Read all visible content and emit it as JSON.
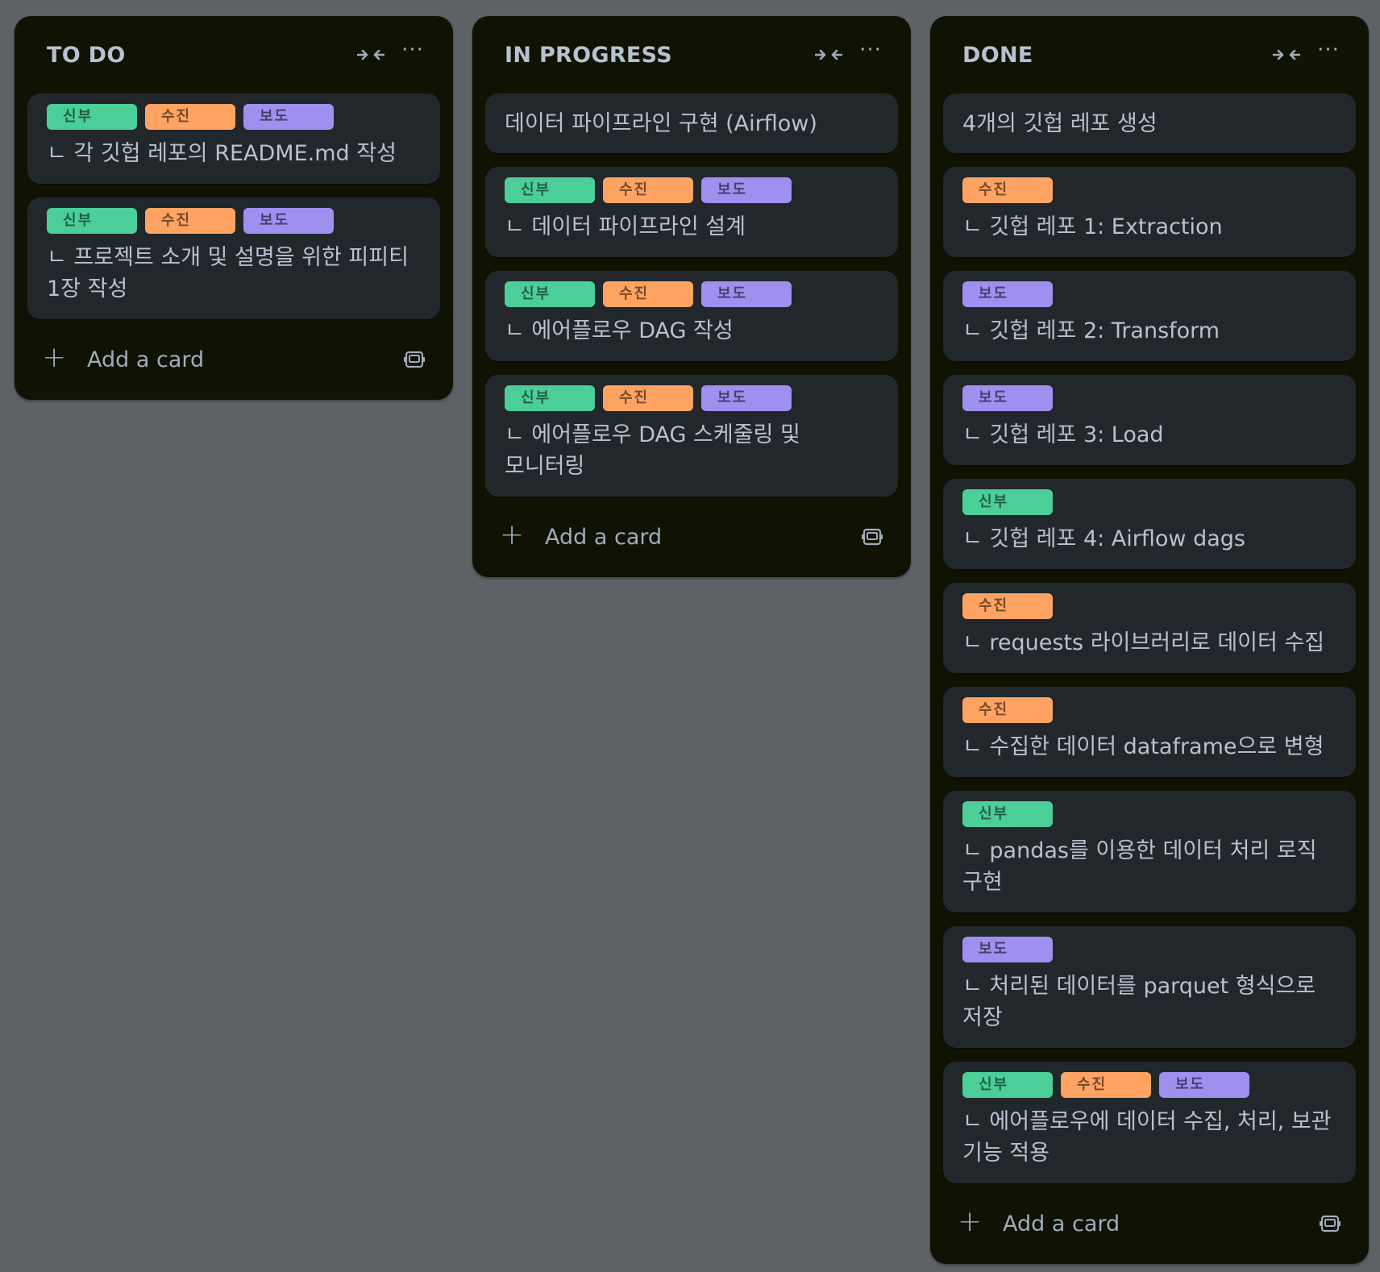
{
  "colors": {
    "background": "#5d6267",
    "list_bg": "#101204",
    "card_bg": "#22272b",
    "text": "#b6c2cf",
    "label_green": "#4bce97",
    "label_orange": "#fea362",
    "label_purple": "#9f8fef"
  },
  "icons": {
    "collapse": "collapse-arrows-icon",
    "menu": "more-dots-icon",
    "add": "plus-icon",
    "template": "card-template-icon"
  },
  "labels": {
    "green": {
      "color": "#4bce97",
      "text": "신부"
    },
    "orange": {
      "color": "#fea362",
      "text": "수진"
    },
    "purple": {
      "color": "#9f8fef",
      "text": "보도"
    }
  },
  "lists": [
    {
      "title": "TO DO",
      "add_label": "Add a card",
      "cards": [
        {
          "labels": [
            "green",
            "orange",
            "purple"
          ],
          "title": "ㄴ 각 깃헙 레포의 README.md 작성"
        },
        {
          "labels": [
            "green",
            "orange",
            "purple"
          ],
          "title": "ㄴ 프로젝트 소개 및 설명을 위한 피피티 1장 작성"
        }
      ]
    },
    {
      "title": "IN PROGRESS",
      "add_label": "Add a card",
      "cards": [
        {
          "labels": [],
          "title": "데이터 파이프라인 구현 (Airflow)"
        },
        {
          "labels": [
            "green",
            "orange",
            "purple"
          ],
          "title": "ㄴ 데이터 파이프라인 설계"
        },
        {
          "labels": [
            "green",
            "orange",
            "purple"
          ],
          "title": "ㄴ 에어플로우 DAG 작성"
        },
        {
          "labels": [
            "green",
            "orange",
            "purple"
          ],
          "title": "ㄴ 에어플로우 DAG 스케줄링 및 모니터링"
        }
      ]
    },
    {
      "title": "DONE",
      "add_label": "Add a card",
      "cards": [
        {
          "labels": [],
          "title": "4개의 깃헙 레포 생성"
        },
        {
          "labels": [
            "orange"
          ],
          "title": "ㄴ 깃헙 레포 1: Extraction"
        },
        {
          "labels": [
            "purple"
          ],
          "title": "ㄴ 깃헙 레포 2: Transform"
        },
        {
          "labels": [
            "purple"
          ],
          "title": "ㄴ 깃헙 레포 3: Load"
        },
        {
          "labels": [
            "green"
          ],
          "title": "ㄴ 깃헙 레포 4: Airflow dags"
        },
        {
          "labels": [
            "orange"
          ],
          "title": "ㄴ requests 라이브러리로 데이터 수집"
        },
        {
          "labels": [
            "orange"
          ],
          "title": "ㄴ 수집한 데이터 dataframe으로 변형"
        },
        {
          "labels": [
            "green"
          ],
          "title": "ㄴ pandas를 이용한 데이터 처리 로직 구현"
        },
        {
          "labels": [
            "purple"
          ],
          "title": "ㄴ 처리된 데이터를 parquet 형식으로 저장"
        },
        {
          "labels": [
            "green",
            "orange",
            "purple"
          ],
          "title": "ㄴ 에어플로우에 데이터 수집, 처리, 보관 기능 적용"
        }
      ]
    }
  ]
}
